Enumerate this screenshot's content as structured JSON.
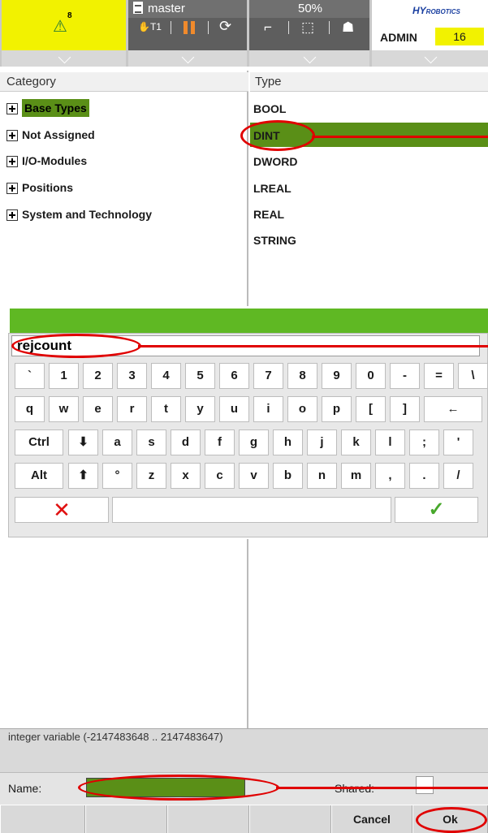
{
  "topbar": {
    "warning_count": "8",
    "program_name": "master",
    "mode": "T1",
    "override": "50%",
    "brand": "HY",
    "brand_sub": "ROBOTICS",
    "user": "ADMIN",
    "user_level": "16"
  },
  "category_panel": {
    "header": "Category",
    "items": [
      "Base Types",
      "Not Assigned",
      "I/O-Modules",
      "Positions",
      "System and Technology"
    ]
  },
  "type_panel": {
    "header": "Type",
    "items": [
      "BOOL",
      "DINT",
      "DWORD",
      "LREAL",
      "REAL",
      "STRING"
    ]
  },
  "keyboard": {
    "input_value": "rejcount",
    "row1": [
      "`",
      "1",
      "2",
      "3",
      "4",
      "5",
      "6",
      "7",
      "8",
      "9",
      "0",
      "-",
      "=",
      "\\"
    ],
    "row2": [
      "q",
      "w",
      "e",
      "r",
      "t",
      "y",
      "u",
      "i",
      "o",
      "p",
      "[",
      "]",
      "←"
    ],
    "row3": [
      "Ctrl",
      "⬇",
      "a",
      "s",
      "d",
      "f",
      "g",
      "h",
      "j",
      "k",
      "l",
      ";",
      "'"
    ],
    "row4": [
      "Alt",
      "⬆",
      "°",
      "z",
      "x",
      "c",
      "v",
      "b",
      "n",
      "m",
      ",",
      ".",
      "/"
    ],
    "cancel_glyph": "✕",
    "ok_glyph": "✓"
  },
  "description": "integer variable (-2147483648 .. 2147483647)",
  "form": {
    "name_label": "Name:",
    "shared_label": "Shared:"
  },
  "buttons": {
    "cancel": "Cancel",
    "ok": "Ok"
  },
  "colors": {
    "selection": "#5a8f17",
    "greenbar": "#5fb823",
    "warning": "#f2f200",
    "annotation": "#e00000"
  }
}
